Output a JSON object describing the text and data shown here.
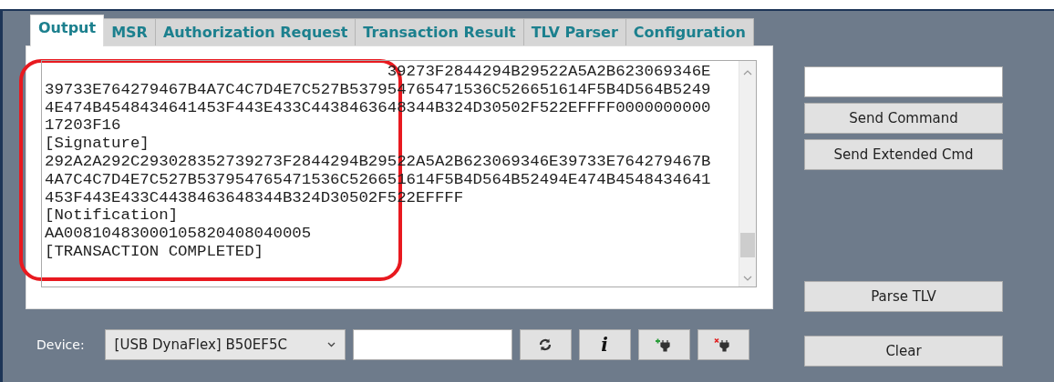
{
  "tabs": [
    {
      "label": "Output",
      "selected": true
    },
    {
      "label": "MSR",
      "selected": false
    },
    {
      "label": "Authorization Request",
      "selected": false
    },
    {
      "label": "Transaction Result",
      "selected": false
    },
    {
      "label": "TLV Parser",
      "selected": false
    },
    {
      "label": "Configuration",
      "selected": false
    }
  ],
  "output": {
    "lines": [
      {
        "kind": "cut",
        "text": "39273F2844294B29522A5A2B623069346E"
      },
      {
        "kind": "line",
        "text": "39733E764279467B4A7C4C7D4E7C527B537954765471536C526651614F5B4D564B5249"
      },
      {
        "kind": "line",
        "text": "4E474B4548434641453F443E433C4438463648344B324D30502F522EFFFF0000000000"
      },
      {
        "kind": "line",
        "text": "17203F16"
      },
      {
        "kind": "line",
        "text": "[Signature]"
      },
      {
        "kind": "line",
        "text": "292A2A292C293028352739273F2844294B29522A5A2B623069346E39733E764279467B"
      },
      {
        "kind": "line",
        "text": "4A7C4C7D4E7C527B537954765471536C526651614F5B4D564B52494E474B4548434641"
      },
      {
        "kind": "line",
        "text": "453F443E433C4438463648344B324D30502F522EFFFF"
      },
      {
        "kind": "line",
        "text": "[Notification]"
      },
      {
        "kind": "line",
        "text": "AA00810483000105820408040005"
      },
      {
        "kind": "line",
        "text": "[TRANSACTION COMPLETED]"
      }
    ]
  },
  "command_buttons": [
    "Send Command",
    "Send Extended Cmd"
  ],
  "parse_button": "Parse TLV",
  "clear_button": "Clear",
  "device": {
    "label": "Device:",
    "value": "[USB DynaFlex] B50EF5C"
  },
  "info_button": "i"
}
